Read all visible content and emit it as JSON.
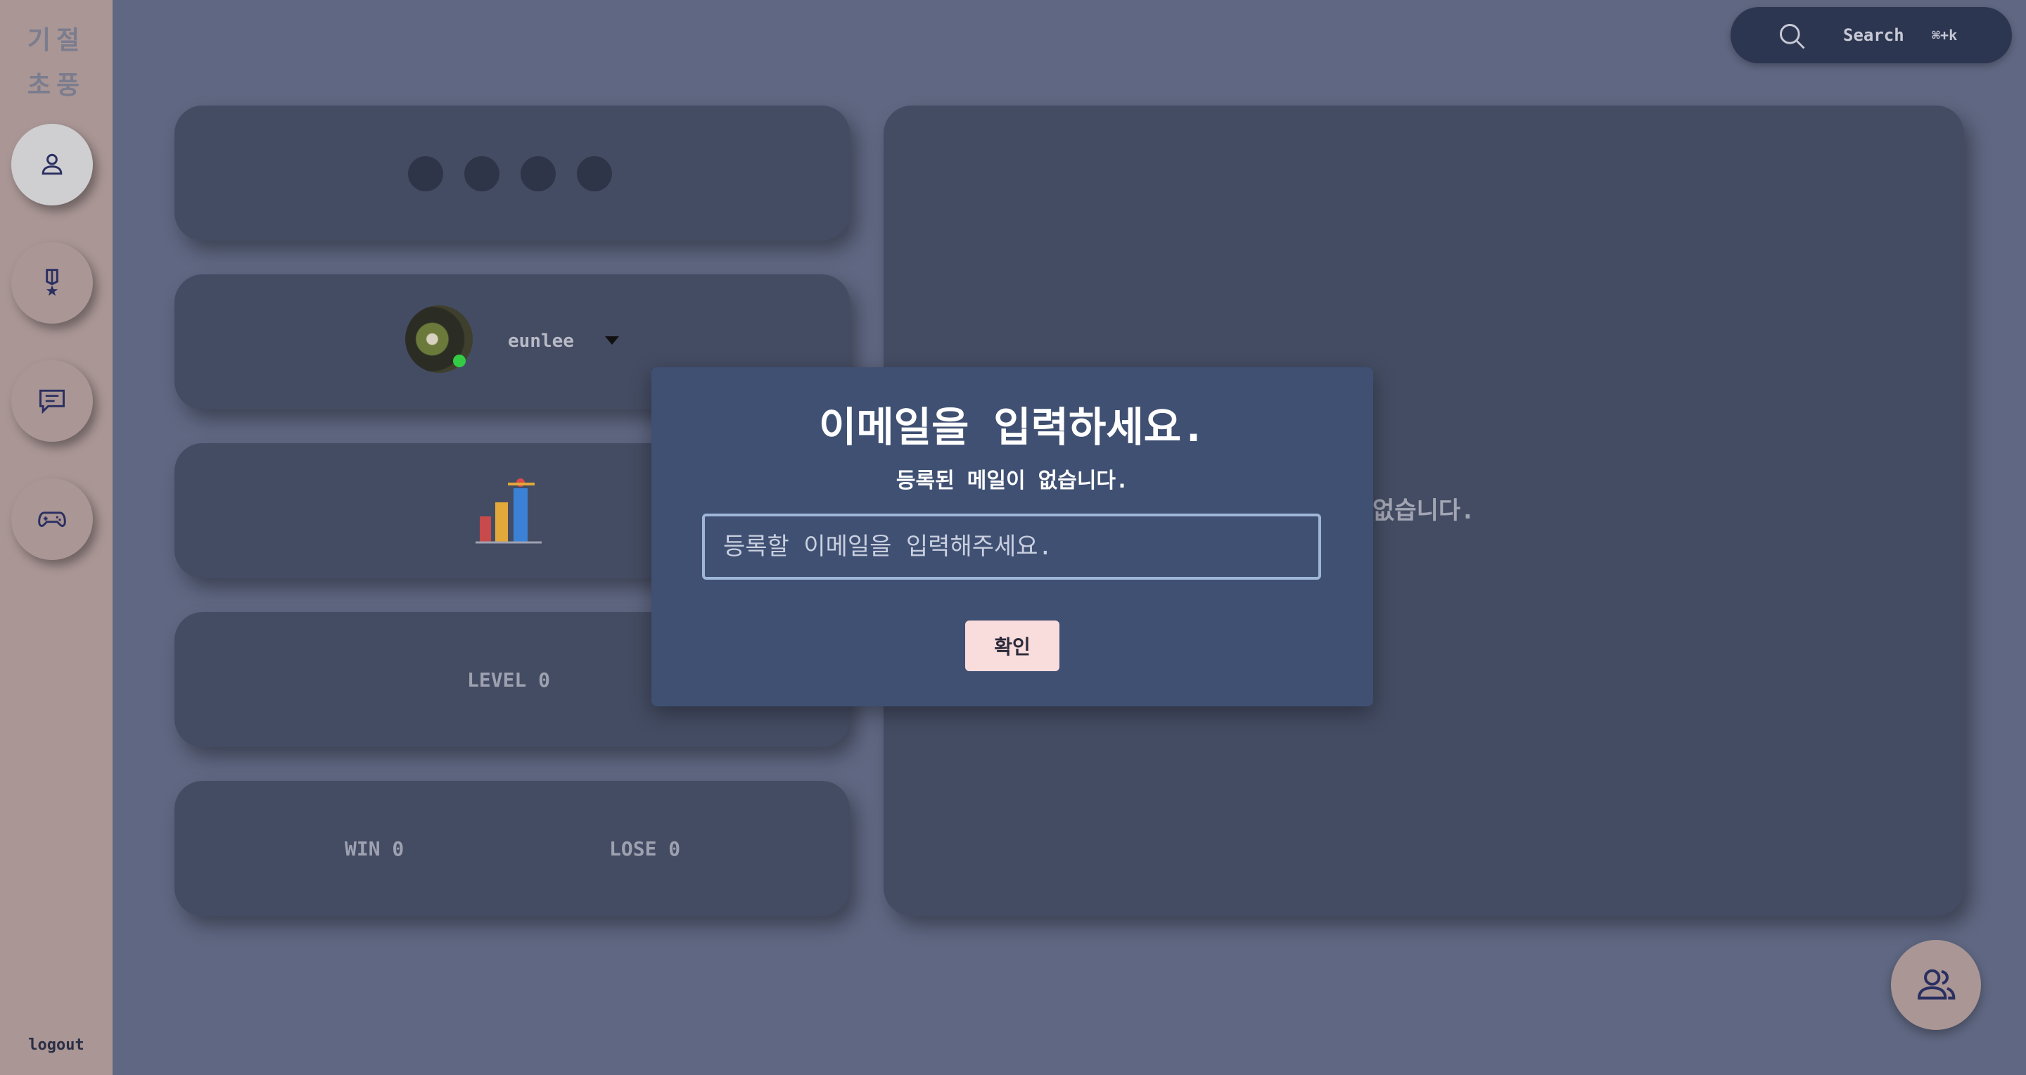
{
  "sidebar": {
    "logo_line1": "기절",
    "logo_line2": "초풍",
    "items": [
      {
        "name": "profile",
        "icon": "person-icon"
      },
      {
        "name": "ranking",
        "icon": "medal-icon"
      },
      {
        "name": "chat",
        "icon": "chat-icon"
      },
      {
        "name": "game",
        "icon": "gamepad-icon"
      }
    ],
    "logout_label": "logout"
  },
  "search": {
    "label": "Search",
    "shortcut": "⌘+k",
    "icon": "search-icon"
  },
  "profile": {
    "username": "eunlee",
    "status": "online",
    "level_label": "LEVEL 0",
    "win_label": "WIN 0",
    "lose_label": "LOSE 0"
  },
  "main": {
    "empty_text": "록이 없습니다."
  },
  "modal": {
    "title": "이메일을 입력하세요.",
    "subtitle": "등록된 메일이 없습니다.",
    "input_placeholder": "등록할 이메일을 입력해주세요.",
    "confirm_label": "확인"
  },
  "colors": {
    "background": "#5f6782",
    "sidebar": "#a99695",
    "card": "#444c63",
    "modal": "#3f5073",
    "confirm_button": "#f9dcdc"
  }
}
